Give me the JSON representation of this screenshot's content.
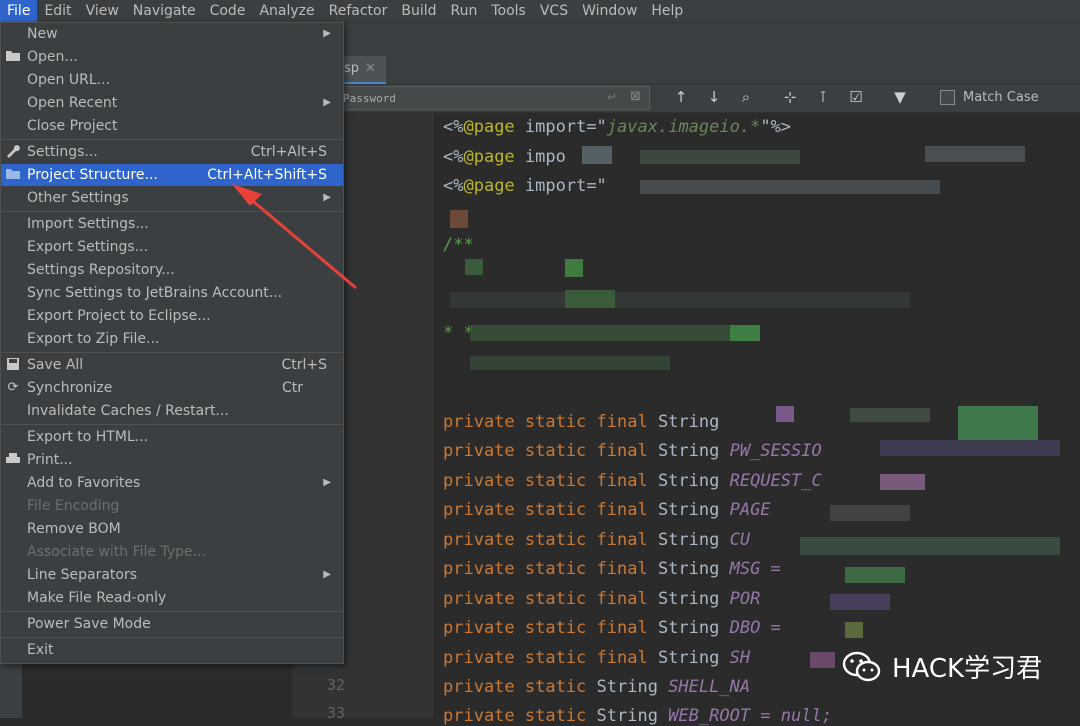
{
  "menubar": {
    "items": [
      "File",
      "Edit",
      "View",
      "Navigate",
      "Code",
      "Analyze",
      "Refactor",
      "Build",
      "Run",
      "Tools",
      "VCS",
      "Window",
      "Help"
    ]
  },
  "editor": {
    "tab_label": "sp",
    "search_value": "Password",
    "match_case": "Match Case",
    "line_numbers": [
      "32",
      "33"
    ],
    "code_lines": [
      {
        "kind": "page",
        "prefix": "<%",
        "ann": "@page",
        "rest": " import=\"",
        "str": "javax.imageio.*",
        "tail": "\"%>"
      },
      {
        "kind": "page",
        "prefix": "<%",
        "ann": "@page",
        "rest": " impo",
        "str": "",
        "tail": ""
      },
      {
        "kind": "page",
        "prefix": "<%",
        "ann": "@page",
        "rest": " import=\"",
        "str": "",
        "tail": ""
      },
      {
        "kind": "comment",
        "text": "/**"
      },
      {
        "kind": "comment",
        "text": "* *"
      },
      {
        "kind": "decl",
        "kw": "private static final",
        "type": " String",
        "name": ""
      },
      {
        "kind": "decl",
        "kw": "private static final",
        "type": " String",
        "name": " PW_SESSIO"
      },
      {
        "kind": "decl",
        "kw": "private static final",
        "type": " String",
        "name": " REQUEST_C"
      },
      {
        "kind": "decl",
        "kw": "private static final",
        "type": " String",
        "name": " PAGE"
      },
      {
        "kind": "decl",
        "kw": "private static final",
        "type": " String",
        "name": " CU"
      },
      {
        "kind": "decl",
        "kw": "private static final",
        "type": " String",
        "name": " MSG ="
      },
      {
        "kind": "decl",
        "kw": "private static final",
        "type": " String",
        "name": " POR"
      },
      {
        "kind": "decl",
        "kw": "private static final",
        "type": " String",
        "name": " DBO ="
      },
      {
        "kind": "decl",
        "kw": "private static final",
        "type": " String",
        "name": " SH"
      },
      {
        "kind": "decl",
        "kw": "private static",
        "type": " String",
        "name": " SHELL_NA"
      },
      {
        "kind": "decl",
        "kw": "private static",
        "type": " String",
        "name": " WEB_ROOT = null;"
      }
    ]
  },
  "file_menu": {
    "items": [
      {
        "label": "New",
        "submenu": true,
        "icon": ""
      },
      {
        "label": "Open...",
        "icon": "folder-icon"
      },
      {
        "label": "Open URL..."
      },
      {
        "label": "Open Recent",
        "submenu": true
      },
      {
        "label": "Close Project"
      },
      {
        "label": "Settings...",
        "shortcut": "Ctrl+Alt+S",
        "icon": "wrench-icon"
      },
      {
        "label": "Project Structure...",
        "shortcut": "Ctrl+Alt+Shift+S",
        "icon": "project-structure-icon",
        "selected": true
      },
      {
        "label": "Other Settings",
        "submenu": true
      },
      {
        "label": "Import Settings..."
      },
      {
        "label": "Export Settings..."
      },
      {
        "label": "Settings Repository..."
      },
      {
        "label": "Sync Settings to JetBrains Account..."
      },
      {
        "label": "Export Project to Eclipse..."
      },
      {
        "label": "Export to Zip File..."
      },
      {
        "label": "Save All",
        "shortcut": "Ctrl+S",
        "icon": "save-icon"
      },
      {
        "label": "Synchronize",
        "shortcut": "Ctr",
        "icon": "sync-icon"
      },
      {
        "label": "Invalidate Caches / Restart..."
      },
      {
        "label": "Export to HTML..."
      },
      {
        "label": "Print...",
        "icon": "print-icon"
      },
      {
        "label": "Add to Favorites",
        "submenu": true
      },
      {
        "label": "File Encoding",
        "disabled": true
      },
      {
        "label": "Remove BOM"
      },
      {
        "label": "Associate with File Type...",
        "disabled": true
      },
      {
        "label": "Line Separators",
        "submenu": true
      },
      {
        "label": "Make File Read-only"
      },
      {
        "label": "Power Save Mode"
      },
      {
        "label": "Exit"
      }
    ]
  },
  "watermark": {
    "text": "HACK学习君"
  },
  "colors": {
    "selection": "#2f65ca",
    "menu_bg": "#3c3f41",
    "editor_bg": "#2b2b2b",
    "keyword": "#cc7832",
    "arrow": "#e8413a"
  }
}
